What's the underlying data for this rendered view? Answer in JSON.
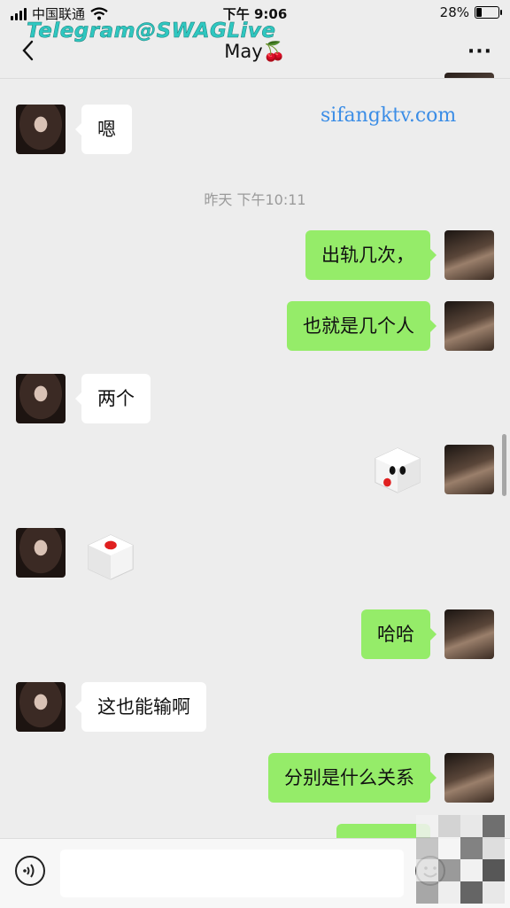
{
  "status_bar": {
    "carrier": "中国联通",
    "time": "下午 9:06",
    "battery_percent": "28%",
    "battery_level": 0.28,
    "icons": [
      "signal-icon",
      "wifi-icon",
      "battery-icon"
    ]
  },
  "header": {
    "title": "May🍒",
    "back_icon": "chevron-left-icon",
    "more_icon": "more-dots-icon",
    "more_label": "···"
  },
  "watermarks": {
    "telegram": "Telegram@SWAGLive",
    "site": "sifangktv.com"
  },
  "messages": [
    {
      "side": "in",
      "type": "text",
      "text": "嗯"
    },
    {
      "type": "timestamp",
      "text": "昨天 下午10:11"
    },
    {
      "side": "out",
      "type": "text",
      "text": "出轨几次，"
    },
    {
      "side": "out",
      "type": "text",
      "text": "也就是几个人"
    },
    {
      "side": "in",
      "type": "text",
      "text": "两个"
    },
    {
      "side": "out",
      "type": "dice",
      "value": 2
    },
    {
      "side": "in",
      "type": "dice",
      "value": 1
    },
    {
      "side": "out",
      "type": "text",
      "text": "哈哈"
    },
    {
      "side": "in",
      "type": "text",
      "text": "这也能输啊"
    },
    {
      "side": "out",
      "type": "text",
      "text": "分别是什么关系"
    }
  ],
  "input_bar": {
    "voice_icon": "voice-icon",
    "emoji_icon": "emoji-icon",
    "value": ""
  },
  "colors": {
    "background": "#ededed",
    "outgoing_bubble": "#95ec69",
    "incoming_bubble": "#ffffff",
    "timestamp": "#9a9a9a",
    "watermark_telegram": "#2fc7c0",
    "watermark_site": "#3b8de6"
  }
}
